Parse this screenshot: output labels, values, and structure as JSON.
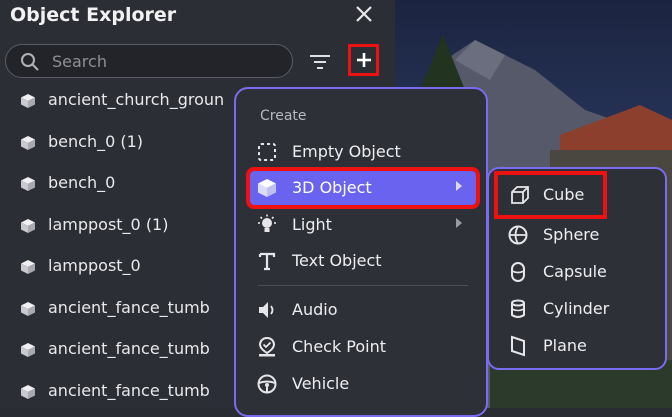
{
  "panel": {
    "title": "Object Explorer",
    "search_placeholder": "Search",
    "icons": {
      "close": "close-icon",
      "search": "search-icon",
      "filter": "filter-icon",
      "add": "plus-icon"
    },
    "objects": [
      "ancient_church_groun",
      "bench_0 (1)",
      "bench_0",
      "lamppost_0 (1)",
      "lamppost_0",
      "ancient_fance_tumb",
      "ancient_fance_tumb",
      "ancient_fance_tumb"
    ]
  },
  "create_menu": {
    "header": "Create",
    "items": [
      {
        "label": "Empty Object",
        "icon": "dashed-square-icon"
      },
      {
        "label": "3D Object",
        "icon": "cube-icon",
        "has_submenu": true,
        "active": true
      },
      {
        "label": "Light",
        "icon": "lightbulb-icon",
        "has_submenu": true
      },
      {
        "label": "Text Object",
        "icon": "text-icon"
      },
      {
        "label": "Audio",
        "icon": "speaker-icon"
      },
      {
        "label": "Check Point",
        "icon": "checkpoint-icon"
      },
      {
        "label": "Vehicle",
        "icon": "steering-wheel-icon"
      }
    ]
  },
  "submenu_3d": {
    "items": [
      {
        "label": "Cube",
        "icon": "cube-outline-icon"
      },
      {
        "label": "Sphere",
        "icon": "sphere-icon"
      },
      {
        "label": "Capsule",
        "icon": "capsule-icon"
      },
      {
        "label": "Cylinder",
        "icon": "cylinder-icon"
      },
      {
        "label": "Plane",
        "icon": "plane-icon"
      }
    ]
  },
  "colors": {
    "accent": "#6a63ef",
    "menu_border": "#7a6cf0",
    "highlight_box": "#ee1111",
    "panel_bg": "#2c2e35"
  }
}
